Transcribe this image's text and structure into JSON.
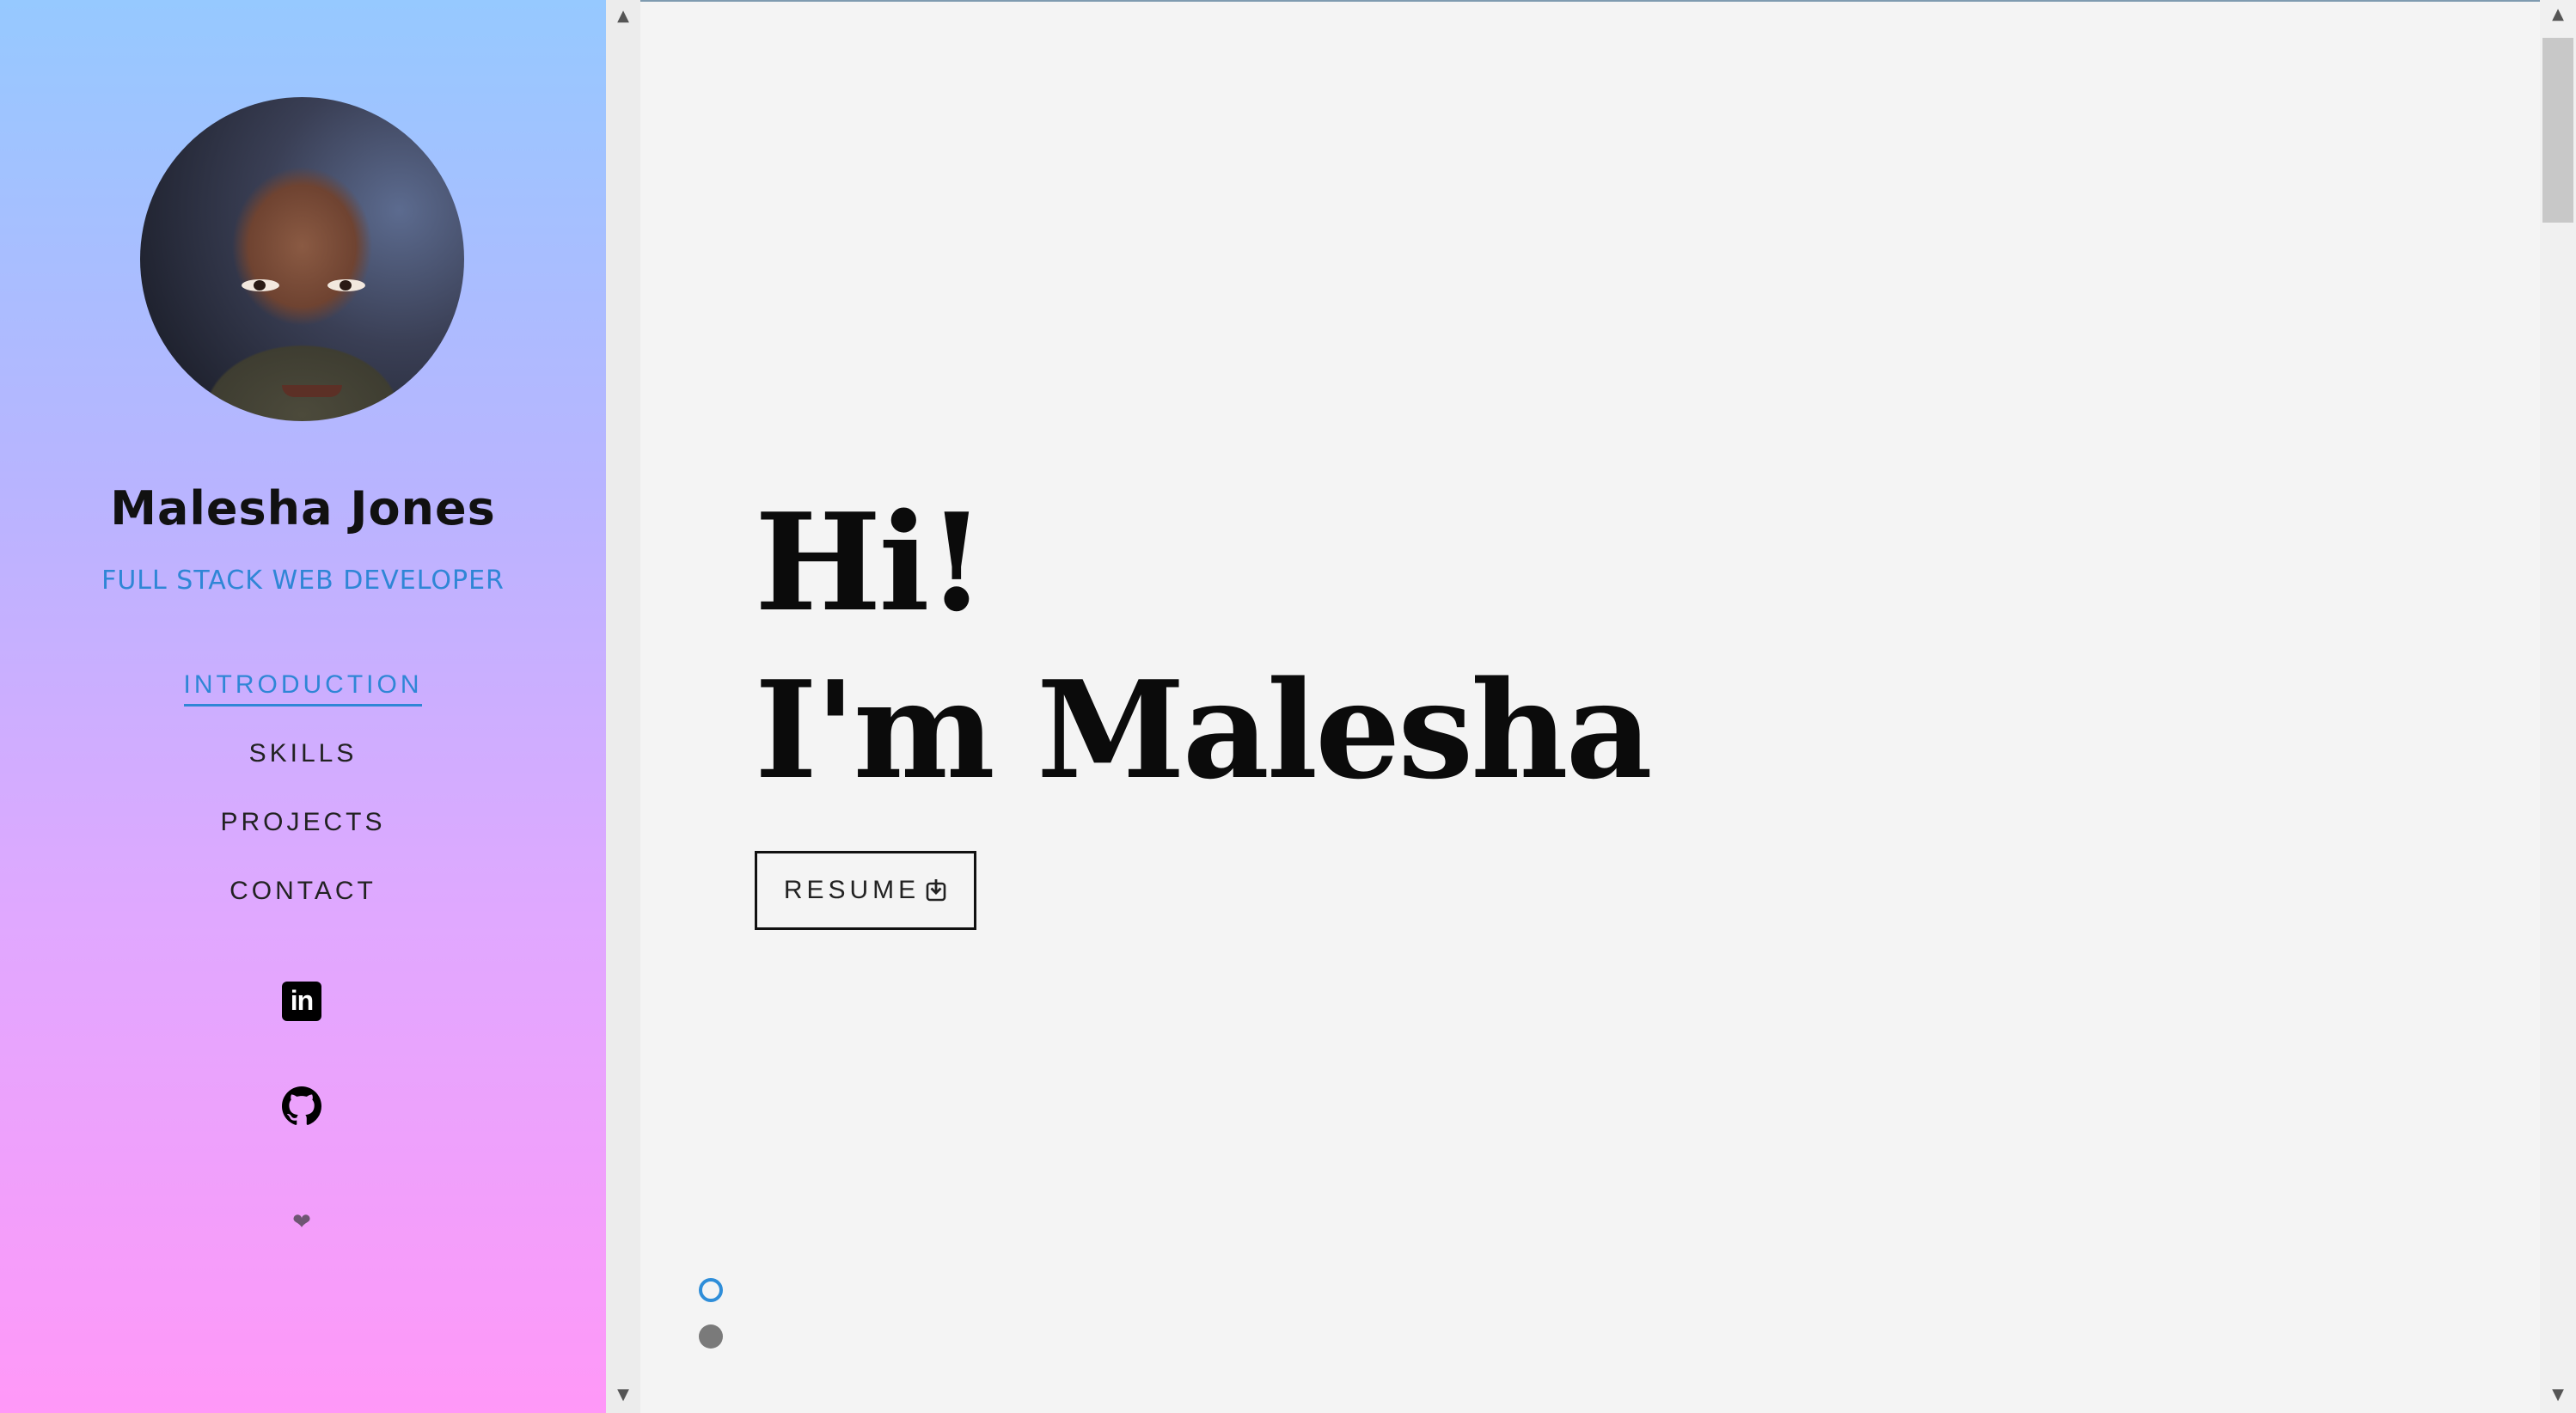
{
  "sidebar": {
    "name": "Malesha Jones",
    "role": "FULL STACK WEB DEVELOPER",
    "nav": [
      {
        "label": "INTRODUCTION",
        "active": true
      },
      {
        "label": "SKILLS",
        "active": false
      },
      {
        "label": "PROJECTS",
        "active": false
      },
      {
        "label": "CONTACT",
        "active": false
      }
    ],
    "social": {
      "linkedin_text": "in",
      "linkedin_icon": "linkedin-icon",
      "github_icon": "github-icon",
      "heart_icon": "heart-icon",
      "heart_glyph": "❤"
    }
  },
  "main": {
    "greeting_line1": "Hi!",
    "greeting_line2": "I'm Malesha",
    "resume_label": "RESUME",
    "resume_icon": "download-icon",
    "pager": {
      "count": 2,
      "active_index": 0
    }
  },
  "colors": {
    "accent": "#2f86d6",
    "sidebar_top": "#96c9ff",
    "sidebar_bottom": "#ff98f8",
    "background": "#f4f4f4"
  }
}
